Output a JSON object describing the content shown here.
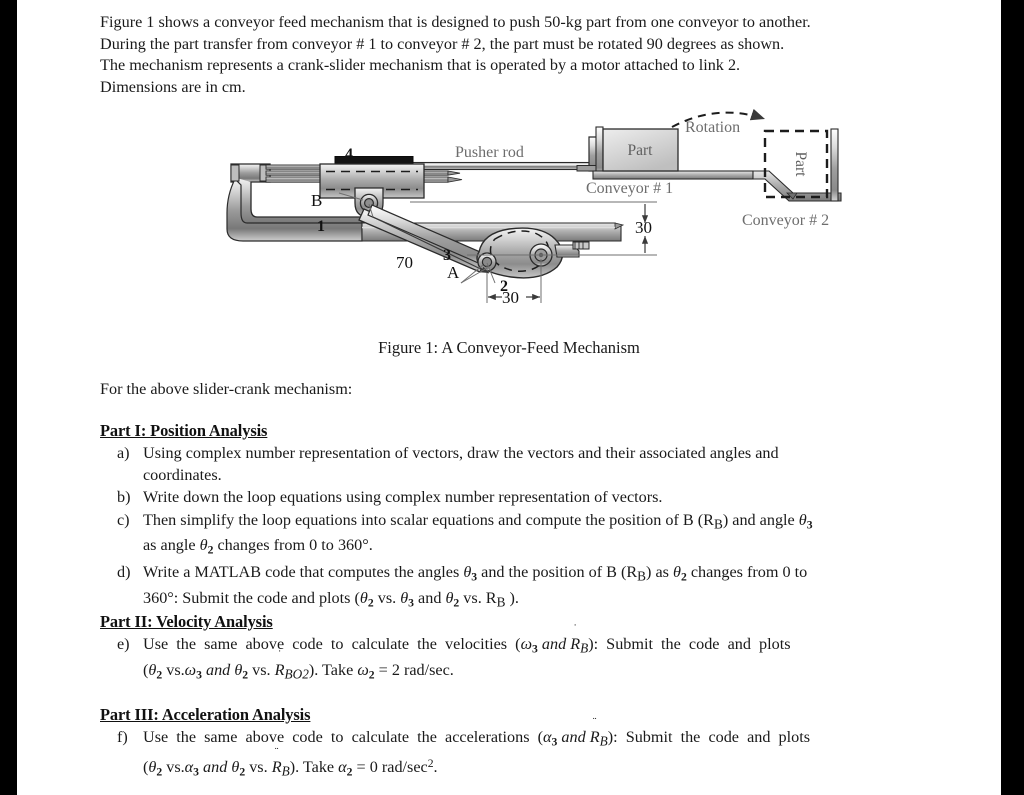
{
  "document": {
    "intro_lines": [
      "Figure 1 shows a conveyor feed mechanism that is designed to push 50-kg part from one conveyor to another.",
      "During the part transfer from conveyor # 1 to conveyor # 2, the part must be rotated 90 degrees as shown.",
      "The mechanism represents a crank-slider mechanism that is operated by a motor attached to link 2.",
      "Dimensions are in cm."
    ],
    "figure_caption": "Figure 1: A Conveyor-Feed Mechanism",
    "lead_text": "For the above slider-crank mechanism:"
  },
  "figure": {
    "labels": {
      "pusher_rod": "Pusher rod",
      "part_1": "Part",
      "part_2": "Part",
      "rotation": "Rotation",
      "conveyor_1": "Conveyor # 1",
      "conveyor_2": "Conveyor # 2"
    },
    "link_numbers": {
      "link1": "1",
      "link2": "2",
      "link3": "3",
      "link4": "4"
    },
    "joints": {
      "a": "A",
      "b": "B"
    },
    "dimensions": {
      "link3_length": "70",
      "height": "30",
      "crank_offset": "30"
    }
  },
  "parts": [
    {
      "heading": "Part I: Position Analysis",
      "items": [
        {
          "mark": "a)",
          "text": "Using complex number representation of vectors, draw the vectors and their associated angles and coordinates."
        },
        {
          "mark": "b)",
          "text": "Write down the loop equations using complex number representation of vectors."
        },
        {
          "mark": "c)",
          "text": "Then simplify the loop equations into scalar equations and compute the position of B (R_B) and angle theta_3 as angle theta_2 changes from 0 to 360°."
        },
        {
          "mark": "d)",
          "text": "Write a MATLAB code that computes the angles theta_3 and the position of B (R_B) as theta_2 changes from 0 to 360°: Submit the code and plots (theta_2 vs. theta_3 and theta_2 vs. R_B )."
        }
      ]
    },
    {
      "heading": "Part II: Velocity Analysis",
      "items": [
        {
          "mark": "e)",
          "text": "Use the same above code to calculate the velocities (omega_3 and Rdot_B): Submit the code and plots (theta_2 vs. omega_3 and theta_2 vs. Rdot_BO2). Take omega_2 = 2 rad/sec."
        }
      ]
    },
    {
      "heading": "Part III: Acceleration Analysis",
      "items": [
        {
          "mark": "f)",
          "text": "Use the same above code to calculate the accelerations (alpha_3 and Rddot_B): Submit the code and plots (theta_2 vs. alpha_3 and theta_2 vs. Rddot_B). Take alpha_2 = 0 rad/sec²."
        }
      ]
    }
  ],
  "colors": {
    "page_background": "#ffffff",
    "letterbox": "#000000",
    "text": "#1a1a1a",
    "figure_label_gray": "#6d6d6d",
    "metal_light": "#e8e8e8",
    "metal_mid": "#b4b4b4",
    "metal_dark": "#6f6f6f",
    "outline": "#2b2b2b"
  }
}
